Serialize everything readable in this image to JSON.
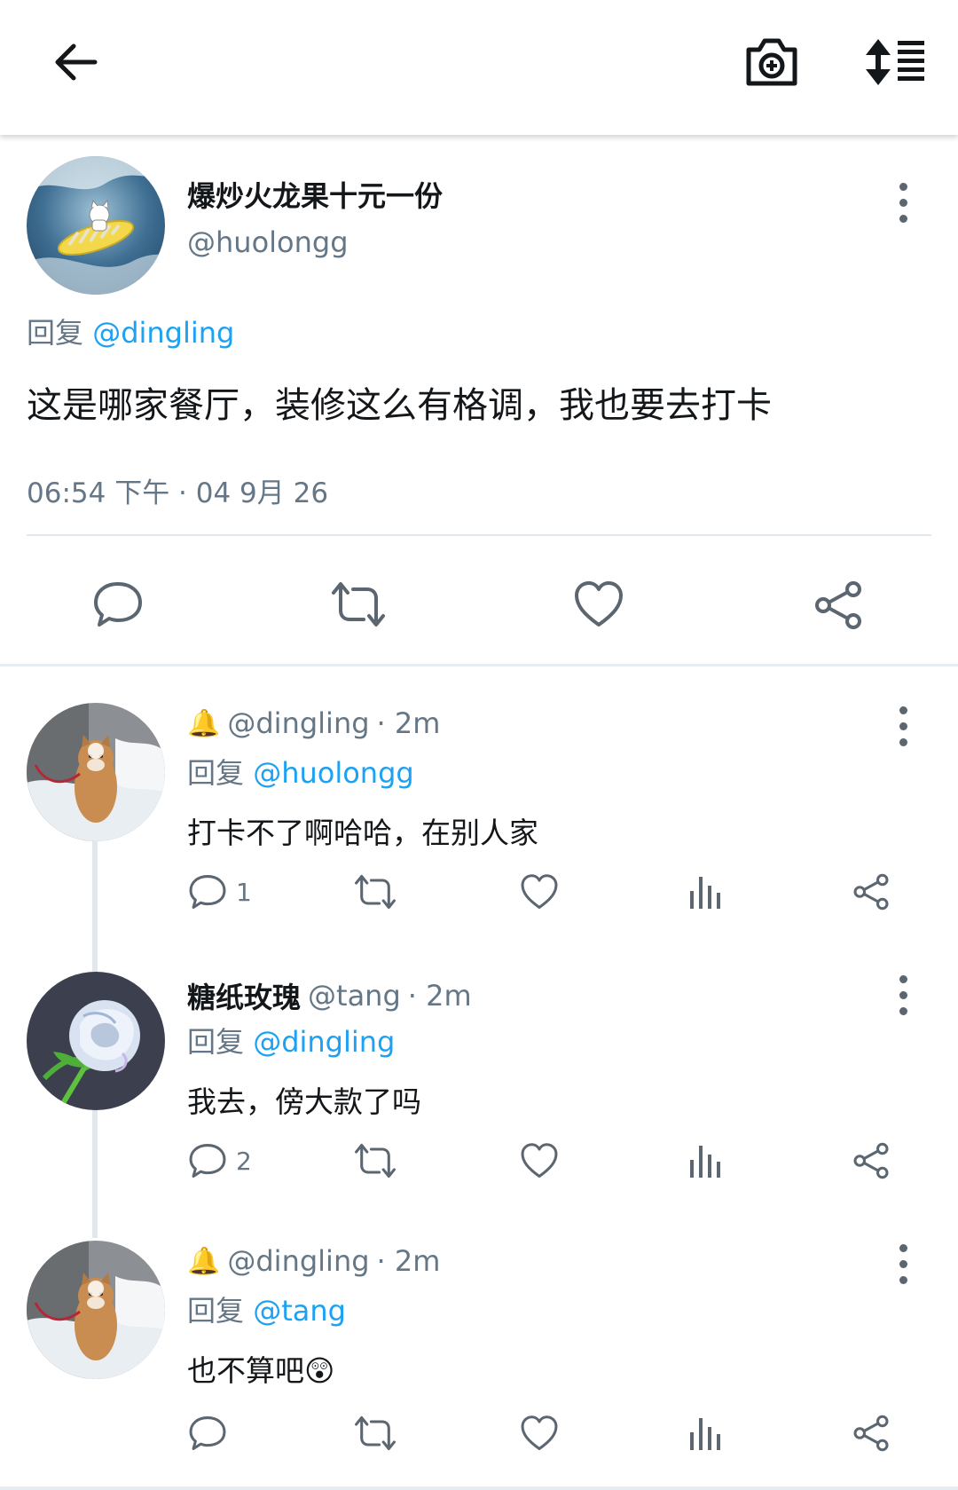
{
  "topbar": {
    "back_icon": "arrow-left-icon",
    "camera_icon": "camera-plus-icon",
    "sort_icon": "sort-list-icon"
  },
  "main_tweet": {
    "display_name": "爆炒火龙果十元一份",
    "handle": "@huolongg",
    "reply_prefix": "回复",
    "reply_to": "@dingling",
    "text": "这是哪家餐厅，装修这么有格调，我也要去打卡",
    "timestamp": "06:54 下午 · 04 9月 26",
    "actions": [
      "reply-icon",
      "retweet-icon",
      "like-icon",
      "share-icon"
    ]
  },
  "replies": [
    {
      "badge": "🔔",
      "display_name": "",
      "handle": "@dingling",
      "time": "· 2m",
      "reply_prefix": "回复",
      "reply_to": "@huolongg",
      "text": "打卡不了啊哈哈，在别人家",
      "reply_count": "1"
    },
    {
      "badge": "",
      "display_name": "糖纸玫瑰",
      "handle": "@tang",
      "time": "· 2m",
      "reply_prefix": "回复",
      "reply_to": "@dingling",
      "text": "我去，傍大款了吗",
      "reply_count": "2"
    },
    {
      "badge": "🔔",
      "display_name": "",
      "handle": "@dingling",
      "time": "· 2m",
      "reply_prefix": "回复",
      "reply_to": "@tang",
      "text": "也不算吧😲",
      "reply_count": ""
    }
  ],
  "colors": {
    "accent": "#1da1f2",
    "secondary_text": "#657786",
    "icon": "#5b6670"
  }
}
